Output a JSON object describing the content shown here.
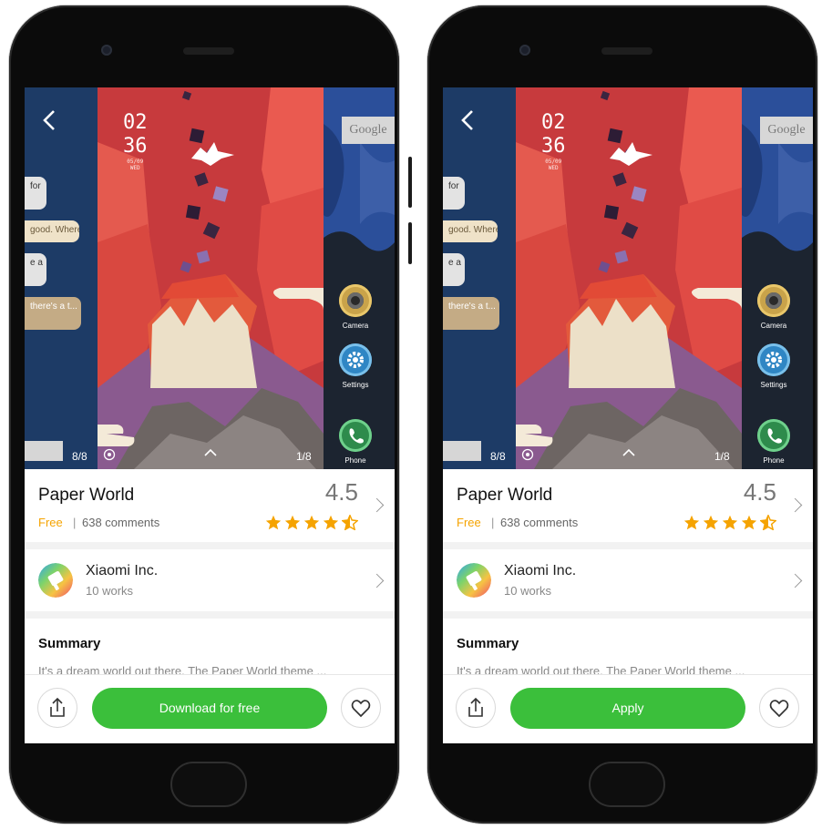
{
  "colors": {
    "accent_green": "#3bbf3b",
    "free_orange": "#f5a300",
    "star_orange": "#f5a300"
  },
  "phones": [
    {
      "lock_time": {
        "hour": "02",
        "minute": "36",
        "date": "05/09",
        "day": "WED"
      },
      "left_counter": "8/8",
      "right_counter": "1/8",
      "google_label": "Google",
      "chat": [
        "for",
        "good. Where?",
        "e a",
        "there's a t..."
      ],
      "apps": [
        {
          "label": "Camera",
          "icon": "camera-icon"
        },
        {
          "label": "Settings",
          "icon": "gear-icon"
        },
        {
          "label": "Phone",
          "icon": "phone-icon"
        }
      ],
      "theme": {
        "title": "Paper World",
        "price": "Free",
        "separator": "|",
        "comments": "638 comments",
        "rating": "4.5",
        "stars": 4.5
      },
      "developer": {
        "name": "Xiaomi Inc.",
        "works": "10 works"
      },
      "summary": {
        "heading": "Summary",
        "text": "It's a dream world out there. The Paper World theme ..."
      },
      "actions": {
        "primary": "Download for free",
        "share_icon": "share-icon",
        "favorite_icon": "heart-icon"
      }
    },
    {
      "lock_time": {
        "hour": "02",
        "minute": "36",
        "date": "05/09",
        "day": "WED"
      },
      "left_counter": "8/8",
      "right_counter": "1/8",
      "google_label": "Google",
      "chat": [
        "for",
        "good. Where?",
        "e a",
        "there's a t..."
      ],
      "apps": [
        {
          "label": "Camera",
          "icon": "camera-icon"
        },
        {
          "label": "Settings",
          "icon": "gear-icon"
        },
        {
          "label": "Phone",
          "icon": "phone-icon"
        }
      ],
      "theme": {
        "title": "Paper World",
        "price": "Free",
        "separator": "|",
        "comments": "638 comments",
        "rating": "4.5",
        "stars": 4.5
      },
      "developer": {
        "name": "Xiaomi Inc.",
        "works": "10 works"
      },
      "summary": {
        "heading": "Summary",
        "text": "It's a dream world out there. The Paper World theme ..."
      },
      "actions": {
        "primary": "Apply",
        "share_icon": "share-icon",
        "favorite_icon": "heart-icon"
      }
    }
  ]
}
